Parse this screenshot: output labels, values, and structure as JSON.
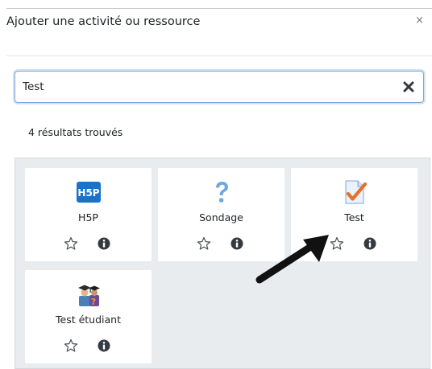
{
  "modal": {
    "title": "Ajouter une activité ou ressource",
    "close_glyph": "×"
  },
  "search": {
    "value": "Test",
    "clear_icon": "clear-icon"
  },
  "results": {
    "count_text": "4 résultats trouvés",
    "items": [
      {
        "name": "H5P",
        "icon": "h5p-icon"
      },
      {
        "name": "Sondage",
        "icon": "question-icon"
      },
      {
        "name": "Test",
        "icon": "quiz-icon"
      },
      {
        "name": "Test étudiant",
        "icon": "student-quiz-icon"
      }
    ]
  },
  "icons": {
    "star": "star-outline-icon",
    "info": "info-icon",
    "annotation": "arrow-icon"
  },
  "colors": {
    "search_focus_border": "#7fa4dd",
    "panel_background": "#e9ecef",
    "h5p_blue": "#1a73c9",
    "question_blue": "#6ea8dc",
    "check_orange": "#e8712a"
  }
}
